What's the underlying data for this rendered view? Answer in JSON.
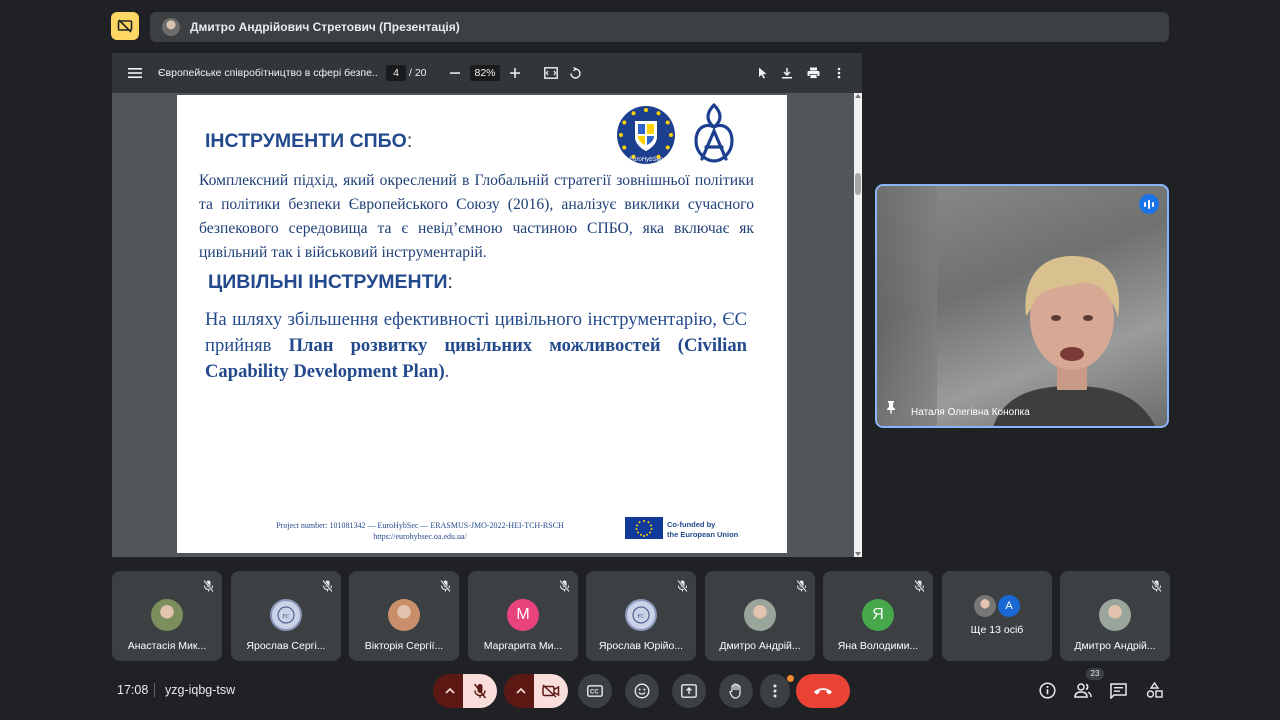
{
  "header": {
    "presenter_label": "Дмитро Андрійович Стретович (Презентація)"
  },
  "pdf": {
    "doc_title": "Європейське співробітництво в сфері безпе...",
    "page_current": "4",
    "page_total": "/ 20",
    "zoom": "82%"
  },
  "slide": {
    "heading1": "ІНСТРУМЕНТИ СПБО",
    "heading1_colon": ":",
    "logo_text": "EuroHybSec",
    "paragraph1": "Комплексний підхід, який окреслений в Глобальній стратегії зовнішньої політики та політики безпеки Європейського Союзу (2016), аналізує виклики сучасного безпекового середовища та є невід’ємною частиною СПБО, яка включає як цивільний так і військовий інструментарій.",
    "heading2": "ЦИВІЛЬНІ ІНСТРУМЕНТИ",
    "heading2_colon": ":",
    "paragraph2_start": "На шляху збільшення ефективності цивільного інструментарію, ЄС прийняв ",
    "paragraph2_bold": "План розвитку цивільних можливостей (Civilian Capability Development Plan)",
    "paragraph2_end": ".",
    "footer_line1": "Project number: 101081342 — EuroHybSec — ERASMUS-JMO-2022-HEI-TCH-RSCH",
    "footer_line2": "https://eurohybsec.oa.edu.ua/",
    "eu_line1": "Co-funded by",
    "eu_line2": "the European Union"
  },
  "self_view": {
    "name": "Наталя Олегівна Конопка"
  },
  "participants": [
    {
      "name": "Анастасія Мик...",
      "avatar": "photo",
      "color": "#7a8f5c"
    },
    {
      "name": "Ярослав Сергі...",
      "avatar": "seal",
      "color": "#c9d2e6"
    },
    {
      "name": "Вікторія Сергії...",
      "avatar": "photo",
      "color": "#c98e6a"
    },
    {
      "name": "Маргарита Ми...",
      "avatar": "М",
      "color": "#e8437d"
    },
    {
      "name": "Ярослав Юрійо...",
      "avatar": "seal",
      "color": "#c9d2e6"
    },
    {
      "name": "Дмитро Андрій...",
      "avatar": "photo",
      "color": "#9aa59c"
    },
    {
      "name": "Яна Володими...",
      "avatar": "Я",
      "color": "#46a84a"
    },
    {
      "name": "Ще 13 осіб",
      "avatar": "group",
      "color": "#3c4043"
    },
    {
      "name": "Дмитро Андрій...",
      "avatar": "photo",
      "color": "#9aa59c"
    }
  ],
  "group_avatar_letter": "A",
  "bottom": {
    "time": "17:08",
    "meeting_code": "yzg-iqbg-tsw",
    "participants_count": "23"
  },
  "colors": {
    "accent": "#8ab4f8",
    "end_call": "#ea4335",
    "mic_off_bg": "#f9dedc",
    "slide_blue": "#234a8c"
  }
}
